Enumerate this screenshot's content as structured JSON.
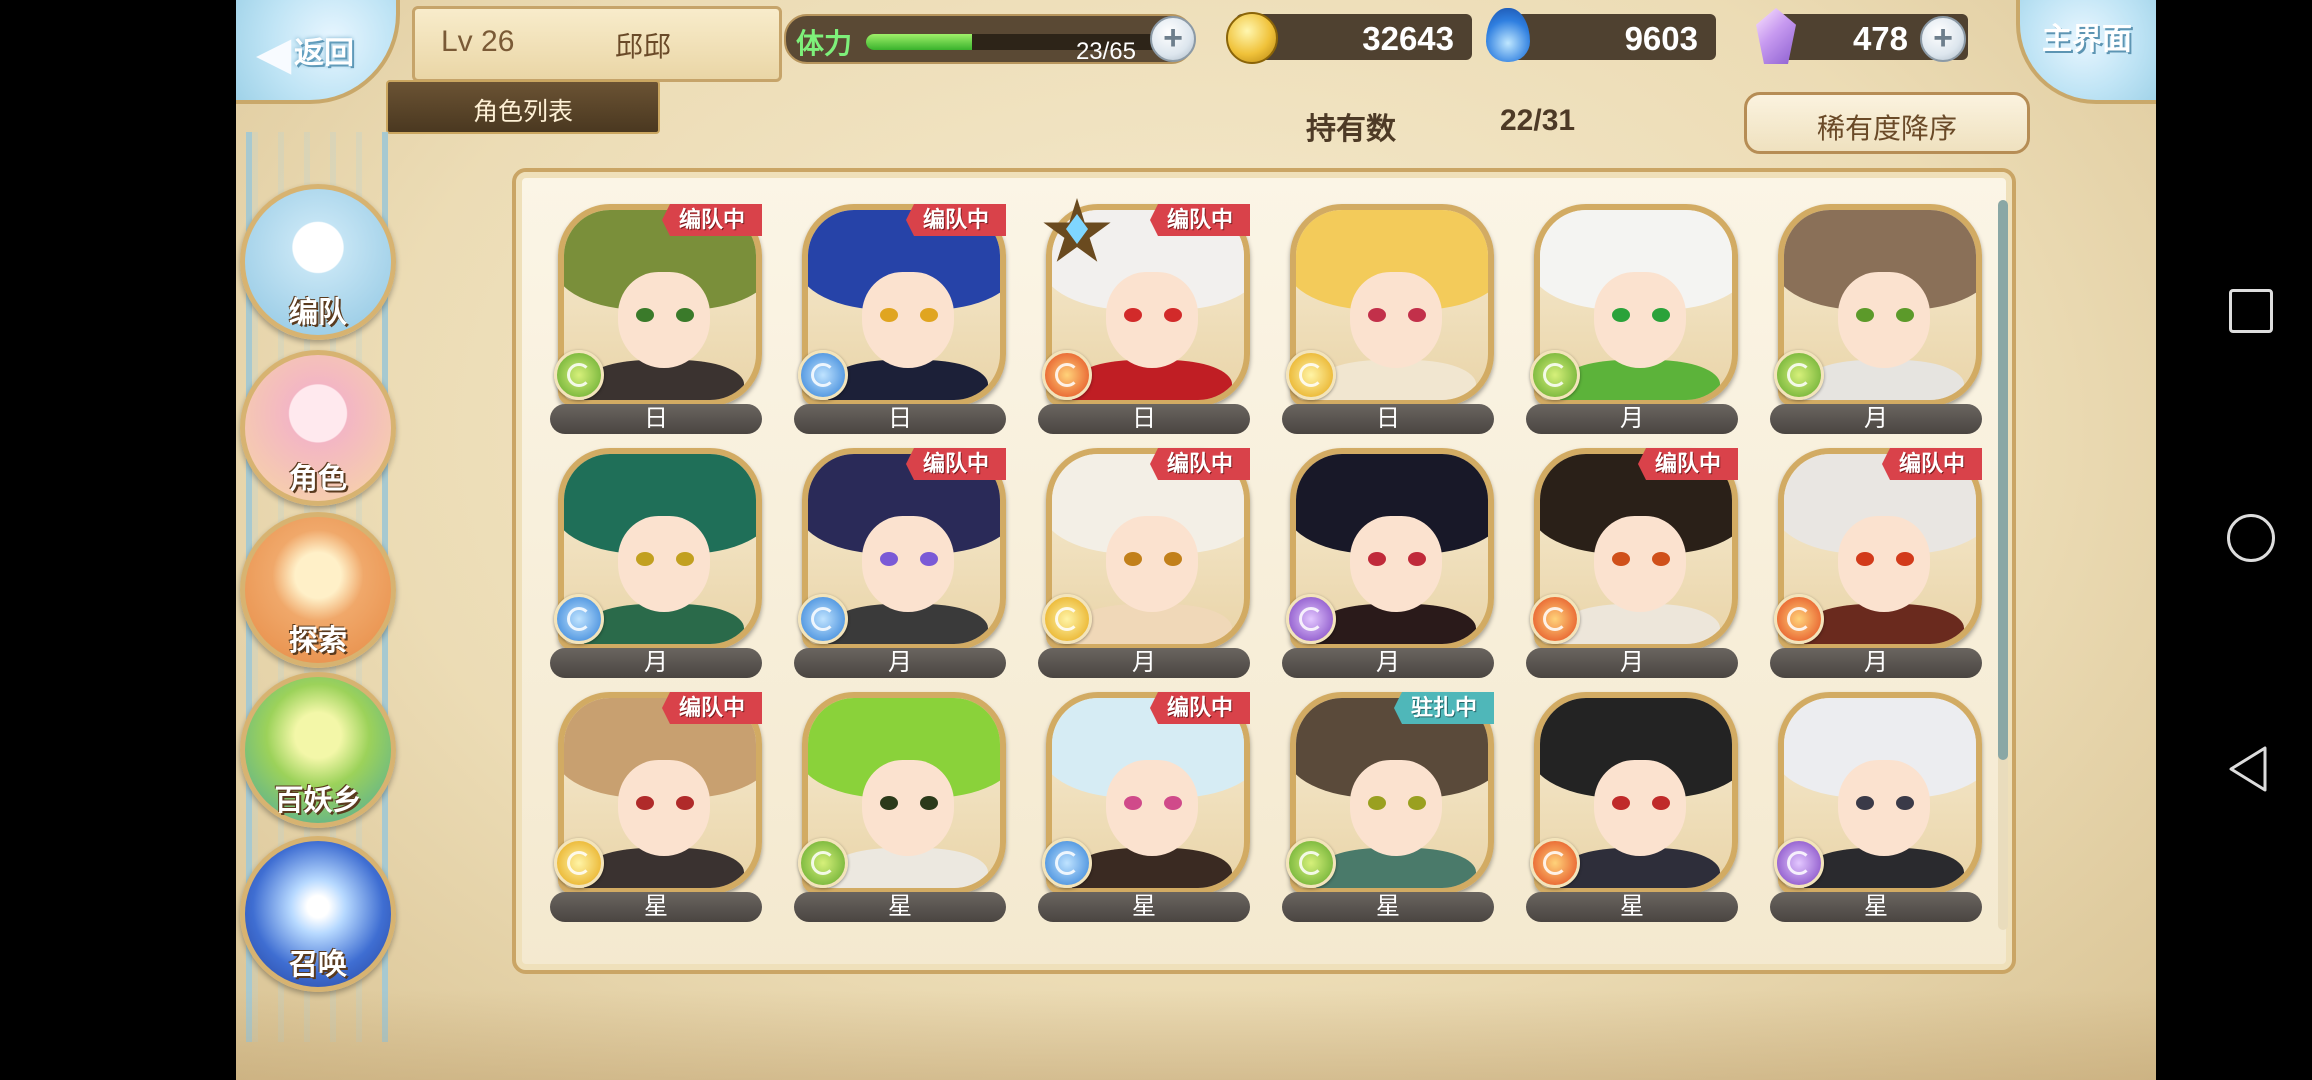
{
  "header": {
    "back_label": "返回",
    "level": "Lv 26",
    "player_name": "邱邱",
    "tab_label": "角色列表",
    "stamina_label": "体力",
    "stamina_value": "23/65",
    "stamina_fraction": 0.354,
    "gold": "32643",
    "soul": "9603",
    "crystal": "478",
    "home_label": "主界面"
  },
  "toolbar": {
    "owned_label": "持有数",
    "owned_value": "22/31",
    "sort_label": "稀有度降序"
  },
  "sidebar": {
    "items": [
      {
        "label": "编队"
      },
      {
        "label": "角色"
      },
      {
        "label": "探索"
      },
      {
        "label": "百妖乡"
      },
      {
        "label": "召唤"
      }
    ]
  },
  "characters": [
    {
      "tag": "日",
      "badge": "编队中",
      "element": "green",
      "hair": "#7a8f3a",
      "eye": "#3a7a2a",
      "body": "#3b3330",
      "star": false
    },
    {
      "tag": "日",
      "badge": "编队中",
      "element": "blue",
      "hair": "#2643a8",
      "eye": "#e0a520",
      "body": "#1c2038",
      "star": false
    },
    {
      "tag": "日",
      "badge": "编队中",
      "element": "red",
      "hair": "#f2f0ee",
      "eye": "#d22a2a",
      "body": "#c01e24",
      "star": true
    },
    {
      "tag": "日",
      "badge": "",
      "element": "gold",
      "hair": "#f3cb5a",
      "eye": "#c2304a",
      "body": "#f1e6d0",
      "star": false
    },
    {
      "tag": "月",
      "badge": "",
      "element": "green",
      "hair": "#f4f4f2",
      "eye": "#2aa23a",
      "body": "#5cb33a",
      "star": false
    },
    {
      "tag": "月",
      "badge": "",
      "element": "green",
      "hair": "#8a7058",
      "eye": "#5c9a2a",
      "body": "#e6e4e0",
      "star": false
    },
    {
      "tag": "月",
      "badge": "",
      "element": "blue",
      "hair": "#1f6f58",
      "eye": "#c2a020",
      "body": "#2a6a4a",
      "star": false
    },
    {
      "tag": "月",
      "badge": "编队中",
      "element": "blue",
      "hair": "#2a2a58",
      "eye": "#7a5ad6",
      "body": "#3a3a3a",
      "star": false
    },
    {
      "tag": "月",
      "badge": "编队中",
      "element": "gold",
      "hair": "#f3efe6",
      "eye": "#c2801a",
      "body": "#f0d8b8",
      "star": false
    },
    {
      "tag": "月",
      "badge": "",
      "element": "purple",
      "hair": "#181828",
      "eye": "#c02a3a",
      "body": "#2a1a1a",
      "star": false
    },
    {
      "tag": "月",
      "badge": "编队中",
      "element": "red",
      "hair": "#2a2018",
      "eye": "#d0501a",
      "body": "#ede6da",
      "star": false
    },
    {
      "tag": "月",
      "badge": "编队中",
      "element": "red",
      "hair": "#e9e6e2",
      "eye": "#d23a1a",
      "body": "#6a2a1e",
      "star": false
    },
    {
      "tag": "星",
      "badge": "编队中",
      "element": "gold",
      "hair": "#c8a070",
      "eye": "#b02a2a",
      "body": "#3a3230",
      "star": false
    },
    {
      "tag": "星",
      "badge": "",
      "element": "green",
      "hair": "#8ad23a",
      "eye": "#2a3a1a",
      "body": "#ece8e0",
      "star": false
    },
    {
      "tag": "星",
      "badge": "编队中",
      "element": "blue",
      "hair": "#d6ecf4",
      "eye": "#d04a8a",
      "body": "#3a2a22",
      "star": false
    },
    {
      "tag": "星",
      "badge": "驻扎中",
      "element": "green",
      "hair": "#5a4a3a",
      "eye": "#9aa020",
      "body": "#4a7a6a",
      "star": false
    },
    {
      "tag": "星",
      "badge": "",
      "element": "red",
      "hair": "#232323",
      "eye": "#c02a2a",
      "body": "#2e2e3a",
      "star": false
    },
    {
      "tag": "星",
      "badge": "",
      "element": "purple",
      "hair": "#ecedf0",
      "eye": "#3a3a48",
      "body": "#2a2a2e",
      "star": false
    }
  ]
}
